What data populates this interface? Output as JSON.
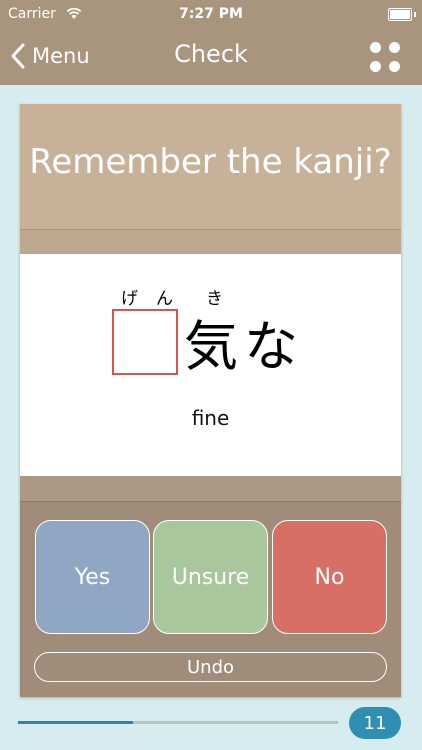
{
  "status_bar": {
    "carrier": "Carrier",
    "time": "7:27 PM"
  },
  "nav": {
    "back_label": "Menu",
    "title": "Check",
    "menu_icon": "grid-dots-icon"
  },
  "card": {
    "question": "Remember the kanji?",
    "furigana": [
      "げ",
      "ん",
      "き"
    ],
    "kana_suffix": "気な",
    "meaning": "fine"
  },
  "buttons": {
    "yes": "Yes",
    "unsure": "Unsure",
    "no": "No",
    "undo": "Undo"
  },
  "progress": {
    "fraction": 0.36,
    "count": "11"
  },
  "colors": {
    "nav_bg": "#a9957e",
    "yes": "#8fa7c3",
    "unsure": "#a8c79c",
    "no": "#d86f64",
    "accent": "#2f8fb2"
  }
}
